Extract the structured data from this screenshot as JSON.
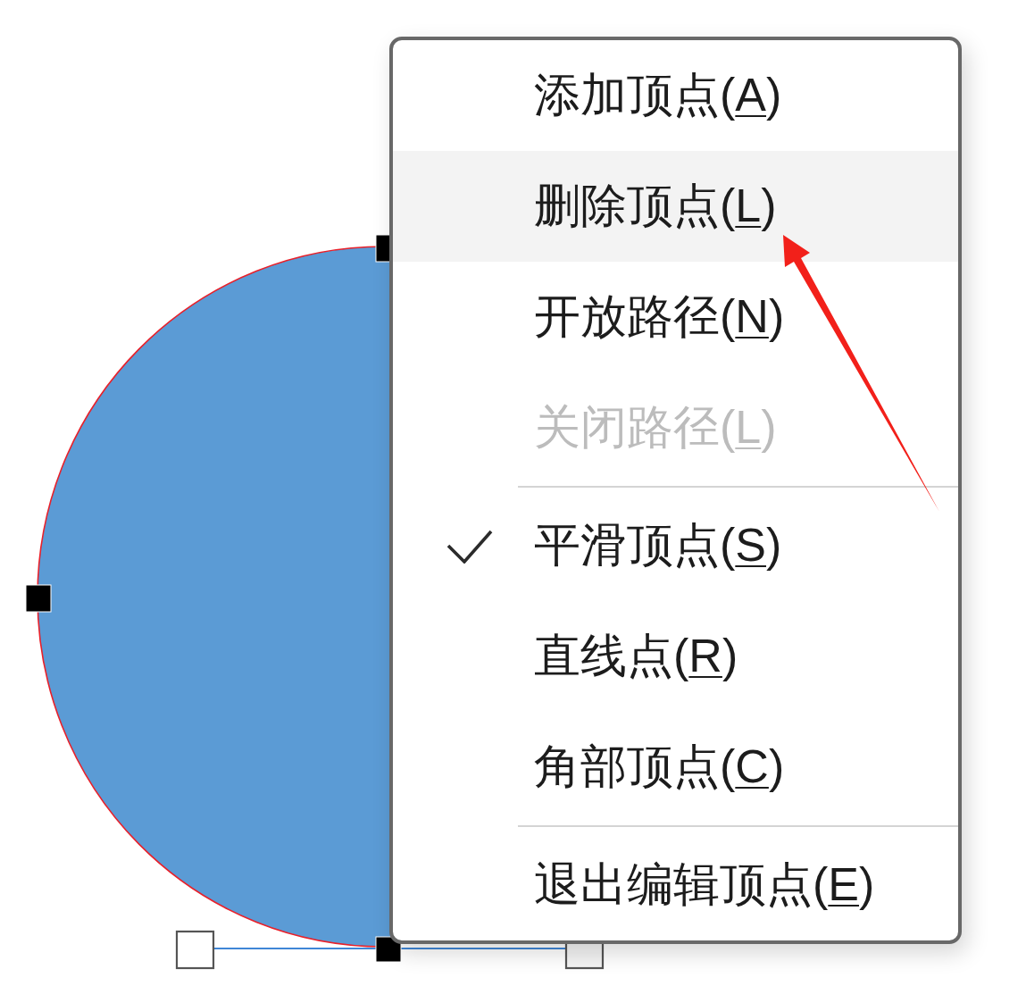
{
  "menu": {
    "groups": [
      {
        "items": [
          {
            "text": "添加顶点(",
            "access_key": "A",
            "text_end": ")",
            "highlighted": false,
            "disabled": false,
            "checked": false
          },
          {
            "text": "删除顶点(",
            "access_key": "L",
            "text_end": ")",
            "highlighted": true,
            "disabled": false,
            "checked": false
          },
          {
            "text": "开放路径(",
            "access_key": "N",
            "text_end": ")",
            "highlighted": false,
            "disabled": false,
            "checked": false
          },
          {
            "text": "关闭路径(",
            "access_key": "L",
            "text_end": ")",
            "highlighted": false,
            "disabled": true,
            "checked": false
          }
        ]
      },
      {
        "items": [
          {
            "text": "平滑顶点(",
            "access_key": "S",
            "text_end": ")",
            "highlighted": false,
            "disabled": false,
            "checked": true
          },
          {
            "text": "直线点(",
            "access_key": "R",
            "text_end": ")",
            "highlighted": false,
            "disabled": false,
            "checked": false
          },
          {
            "text": "角部顶点(",
            "access_key": "C",
            "text_end": ")",
            "highlighted": false,
            "disabled": false,
            "checked": false
          }
        ]
      },
      {
        "items": [
          {
            "text": "退出编辑顶点(",
            "access_key": "E",
            "text_end": ")",
            "highlighted": false,
            "disabled": false,
            "checked": false
          }
        ]
      }
    ]
  }
}
